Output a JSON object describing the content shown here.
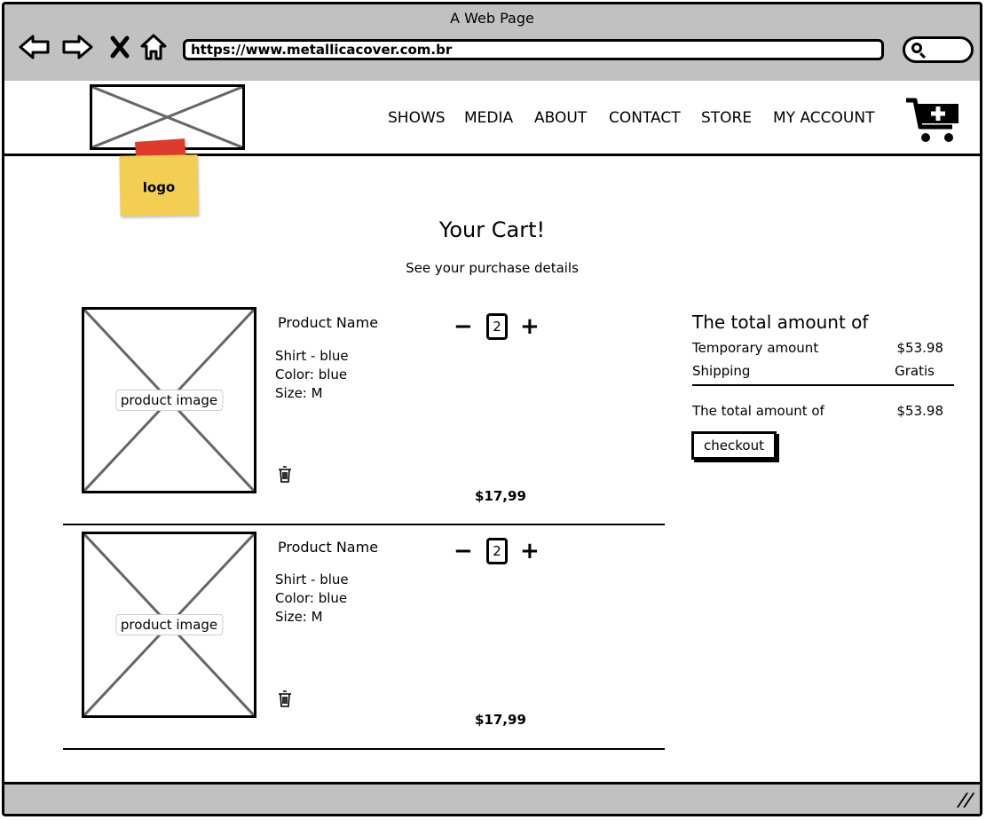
{
  "window": {
    "title": "A Web Page"
  },
  "browser": {
    "url": "https://www.metallicacover.com.br"
  },
  "header": {
    "logo_note": "logo",
    "nav": [
      "SHOWS",
      "MEDIA",
      "ABOUT",
      "CONTACT",
      "STORE",
      "MY ACCOUNT"
    ]
  },
  "page": {
    "title": "Your Cart!",
    "subtitle": "See your purchase details"
  },
  "cart": {
    "items": [
      {
        "image_label": "product image",
        "name": "Product Name",
        "line1": "Shirt - blue",
        "line2": "Color: blue",
        "line3": "Size: M",
        "quantity": "2",
        "price": "$17,99"
      },
      {
        "image_label": "product image",
        "name": "Product Name",
        "line1": "Shirt - blue",
        "line2": "Color: blue",
        "line3": "Size: M",
        "quantity": "2",
        "price": "$17,99"
      }
    ]
  },
  "summary": {
    "title": "The total amount of",
    "temporary_label": "Temporary amount",
    "temporary_value": "$53.98",
    "shipping_label": "Shipping",
    "shipping_value": "Gratis",
    "total_label": "The total amount of",
    "total_value": "$53.98",
    "checkout_label": "checkout"
  },
  "icons": {
    "back": "back-arrow-icon",
    "forward": "forward-arrow-icon",
    "stop": "close-icon",
    "home": "home-icon",
    "search": "search-icon",
    "cart": "cart-add-icon",
    "trash": "trash-icon",
    "resize": "resize-grip-icon"
  },
  "colors": {
    "chrome": "#c1c1c1",
    "sticky_note": "#f4cd53",
    "tape": "#de3a2e"
  }
}
